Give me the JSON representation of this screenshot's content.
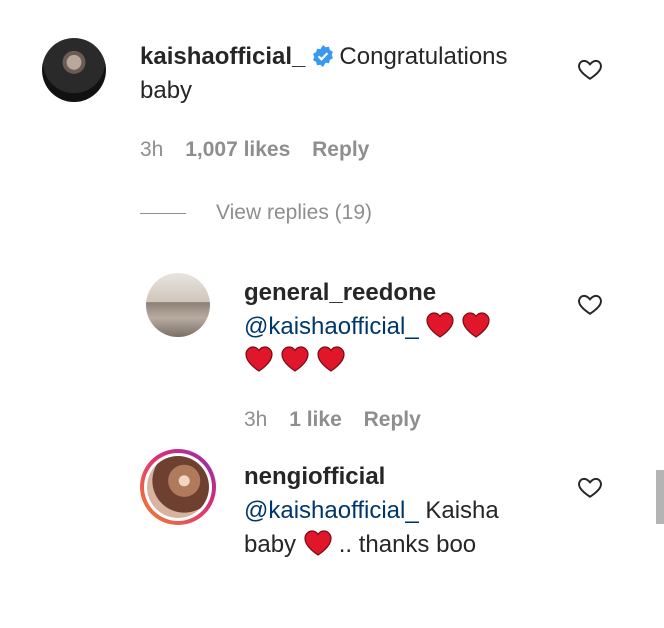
{
  "comments": [
    {
      "username": "kaishaofficial_",
      "verified": true,
      "text_line1": "Congratulations",
      "text_line2": "baby",
      "time": "3h",
      "likes": "1,007 likes",
      "reply": "Reply",
      "view_replies": "View replies (19)"
    },
    {
      "username": "general_reedone",
      "mention": "@kaishaofficial_",
      "hearts_line1": 2,
      "hearts_line2": 3,
      "time": "3h",
      "likes": "1 like",
      "reply": "Reply"
    },
    {
      "username": "nengiofficial",
      "mention": "@kaishaofficial_",
      "text_after_mention": "Kaisha",
      "text_line2_before": "baby",
      "text_line2_after": ".. thanks boo"
    }
  ],
  "colors": {
    "heart": "#ed4956",
    "verified": "#3897f0",
    "mention": "#00376b",
    "meta": "#8e8e8e"
  },
  "icons": {
    "like": "heart-outline-icon",
    "verified": "verified-badge-icon",
    "emoji": "red-heart-emoji"
  }
}
